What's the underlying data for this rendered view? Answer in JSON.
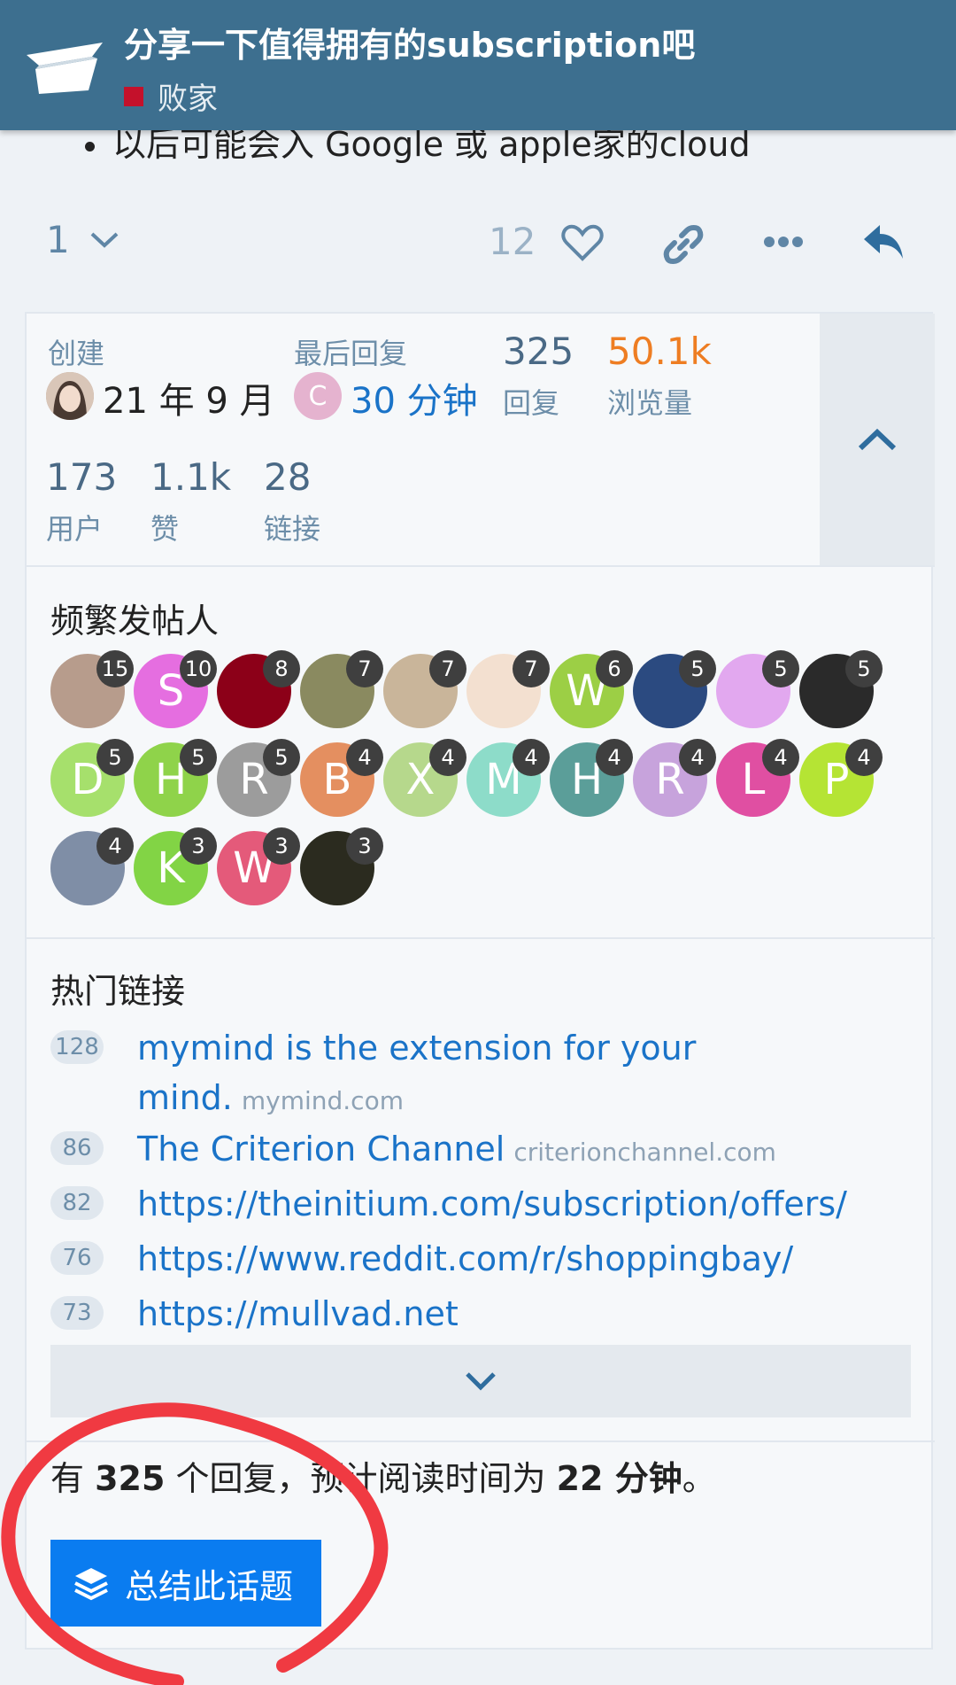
{
  "header": {
    "title": "分享一下值得拥有的subscription吧",
    "category": "败家",
    "category_color": "#c4112b",
    "bg_color": "#3d6f8f"
  },
  "post": {
    "bullet_text": "以后可能会入 Google 或 apple家的cloud"
  },
  "actions": {
    "expand_count": "1",
    "like_count": "12"
  },
  "stats": {
    "created_label": "创建",
    "created_value": "21 年 9 月",
    "last_reply_label": "最后回复",
    "last_reply_avatar_letter": "C",
    "last_reply_value": "30 分钟",
    "replies_value": "325",
    "replies_label": "回复",
    "views_value": "50.1k",
    "views_label": "浏览量",
    "users_value": "173",
    "users_label": "用户",
    "likes_value": "1.1k",
    "likes_label": "赞",
    "links_value": "28",
    "links_label": "链接"
  },
  "frequent": {
    "title": "频繁发帖人",
    "posters": [
      {
        "letter": "",
        "color": "#b79c8c",
        "count": "15"
      },
      {
        "letter": "S",
        "color": "#e56ee0",
        "count": "10"
      },
      {
        "letter": "",
        "color": "#8c0018",
        "count": "8"
      },
      {
        "letter": "",
        "color": "#8a8a60",
        "count": "7"
      },
      {
        "letter": "",
        "color": "#c9b59a",
        "count": "7"
      },
      {
        "letter": "",
        "color": "#f3e0d0",
        "count": "7"
      },
      {
        "letter": "W",
        "color": "#9ccf45",
        "count": "6"
      },
      {
        "letter": "",
        "color": "#2b4a80",
        "count": "5"
      },
      {
        "letter": "",
        "color": "#e2a8ef",
        "count": "5"
      },
      {
        "letter": "",
        "color": "#2a2a2a",
        "count": "5"
      },
      {
        "letter": "D",
        "color": "#a6e06c",
        "count": "5"
      },
      {
        "letter": "H",
        "color": "#8fd34a",
        "count": "5"
      },
      {
        "letter": "R",
        "color": "#9c9c9c",
        "count": "5"
      },
      {
        "letter": "B",
        "color": "#e48f60",
        "count": "4"
      },
      {
        "letter": "X",
        "color": "#b6d88c",
        "count": "4"
      },
      {
        "letter": "M",
        "color": "#8ddcc9",
        "count": "4"
      },
      {
        "letter": "H",
        "color": "#5b9e99",
        "count": "4"
      },
      {
        "letter": "R",
        "color": "#c7a3dc",
        "count": "4"
      },
      {
        "letter": "L",
        "color": "#e04fa2",
        "count": "4"
      },
      {
        "letter": "P",
        "color": "#b5e434",
        "count": "4"
      },
      {
        "letter": "",
        "color": "#7f8ea6",
        "count": "4"
      },
      {
        "letter": "K",
        "color": "#82d445",
        "count": "3"
      },
      {
        "letter": "W",
        "color": "#e45a7a",
        "count": "3"
      },
      {
        "letter": "",
        "color": "#2b2b1f",
        "count": "3"
      }
    ]
  },
  "popular_links": {
    "title": "热门链接",
    "items": [
      {
        "count": "128",
        "text": "mymind is the extension for your mind.",
        "domain": "mymind.com"
      },
      {
        "count": "86",
        "text": "The Criterion Channel",
        "domain": "criterionchannel.com"
      },
      {
        "count": "82",
        "text": "https://theinitium.com/subscription/offers/",
        "domain": ""
      },
      {
        "count": "76",
        "text": "https://www.reddit.com/r/shoppingbay/",
        "domain": ""
      },
      {
        "count": "73",
        "text": "https://mullvad.net",
        "domain": ""
      }
    ]
  },
  "summary": {
    "prefix": "有 ",
    "replies": "325",
    "middle": " 个回复，预计阅读时间为 ",
    "minutes": "22 分钟",
    "suffix": "。",
    "button_label": "总结此话题"
  }
}
